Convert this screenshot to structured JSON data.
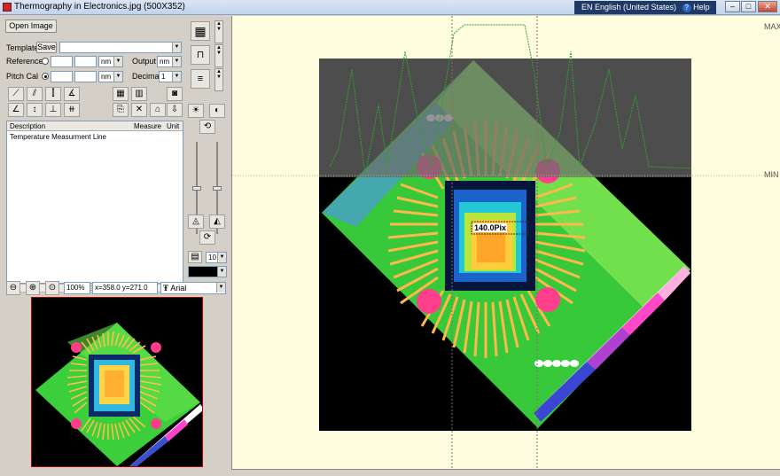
{
  "window": {
    "title": "Thermography in Electronics.jpg  (500X352)"
  },
  "langbar": {
    "language": "EN English (United States)",
    "help": "Help"
  },
  "controls": {
    "open_image": "Open Image",
    "template_label": "Template",
    "save_label": "Save",
    "reference_label": "Reference",
    "reference_unit": "nm",
    "output_label": "Output",
    "output_unit": "nm",
    "pitch_label": "Pitch Cal",
    "pitch_unit": "nm",
    "decimal_label": "Decimal",
    "decimal_value": "1"
  },
  "table": {
    "headers": [
      "Description",
      "Measure",
      "Unit"
    ],
    "rows": [
      {
        "description": "Temperature Measurment Line",
        "measure": "",
        "unit": ""
      }
    ]
  },
  "zoom": {
    "level": "100%",
    "coords": "x=358.0 y=271.0",
    "font": "Arial"
  },
  "side": {
    "font_size": "10"
  },
  "viewport": {
    "max_label": "MAX",
    "min_label": "MIN",
    "measurement": "140.0Pix"
  },
  "colors": {
    "background": "#fffde0",
    "plot_line": "#2fa32f",
    "band": "#6b6b6b"
  }
}
